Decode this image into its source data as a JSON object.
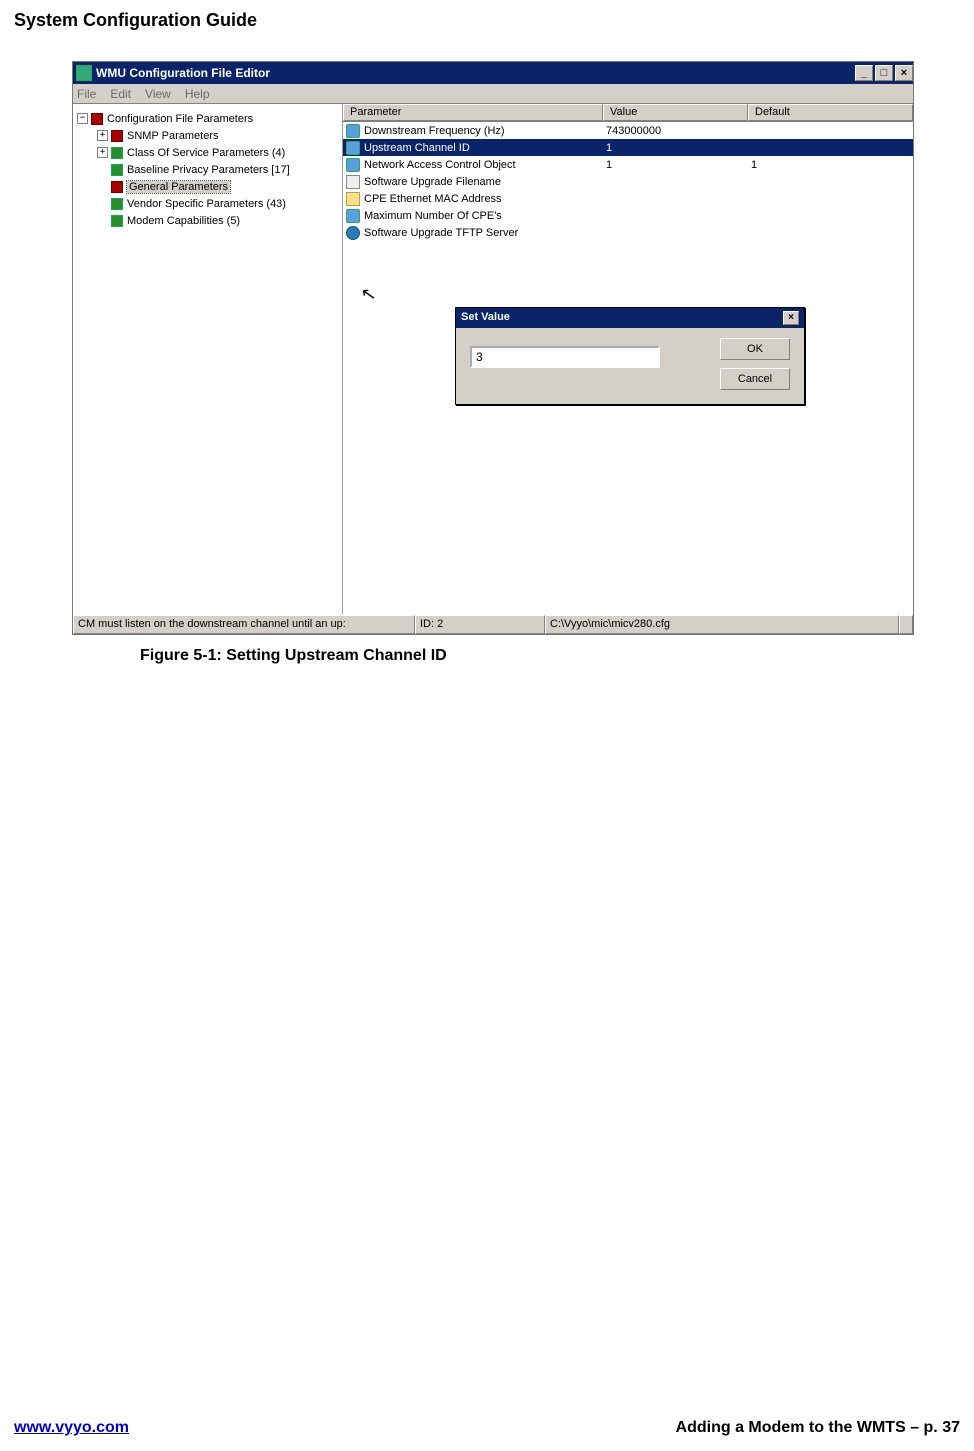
{
  "page": {
    "header": "System Configuration Guide",
    "figure_caption": "Figure 5-1: Setting Upstream Channel ID",
    "footer_left": "www.vyyo.com",
    "footer_right": "Adding a Modem to the WMTS – p. 37"
  },
  "window": {
    "title": "WMU Configuration File Editor",
    "menu": {
      "file": "File",
      "edit": "Edit",
      "view": "View",
      "help": "Help"
    },
    "winbtns": {
      "min": "_",
      "max": "□",
      "close": "×"
    }
  },
  "tree": {
    "root": "Configuration File Parameters",
    "items": [
      {
        "label": "SNMP Parameters",
        "icon": "red",
        "expand": "+"
      },
      {
        "label": "Class Of Service Parameters (4)",
        "icon": "green",
        "expand": "+"
      },
      {
        "label": "Baseline Privacy Parameters [17]",
        "icon": "green",
        "expand": ""
      },
      {
        "label": "General Parameters",
        "icon": "red",
        "expand": "",
        "selected": true
      },
      {
        "label": "Vendor Specific Parameters (43)",
        "icon": "green",
        "expand": ""
      },
      {
        "label": "Modem Capabilities (5)",
        "icon": "green",
        "expand": ""
      }
    ]
  },
  "list": {
    "headers": {
      "param": "Parameter",
      "value": "Value",
      "def": "Default"
    },
    "rows": [
      {
        "icon": "blue",
        "param": "Downstream Frequency  (Hz)",
        "value": "743000000",
        "def": ""
      },
      {
        "icon": "blue",
        "param": "Upstream Channel ID",
        "value": "1",
        "def": "",
        "selected": true
      },
      {
        "icon": "blue",
        "param": "Network Access Control Object",
        "value": "1",
        "def": "1"
      },
      {
        "icon": "tool",
        "param": "Software Upgrade Filename",
        "value": "",
        "def": ""
      },
      {
        "icon": "card",
        "param": "CPE Ethernet MAC Address",
        "value": "",
        "def": ""
      },
      {
        "icon": "blue",
        "param": "Maximum Number Of CPE's",
        "value": "",
        "def": ""
      },
      {
        "icon": "globe",
        "param": "Software Upgrade TFTP Server",
        "value": "",
        "def": ""
      }
    ]
  },
  "dialog": {
    "title": "Set Value",
    "close": "×",
    "input_value": "3",
    "ok": "OK",
    "cancel": "Cancel"
  },
  "status": {
    "s1": "CM must listen on the downstream channel until an up:",
    "s2": "ID: 2",
    "s3": "C:\\Vyyo\\mic\\micv280.cfg"
  }
}
